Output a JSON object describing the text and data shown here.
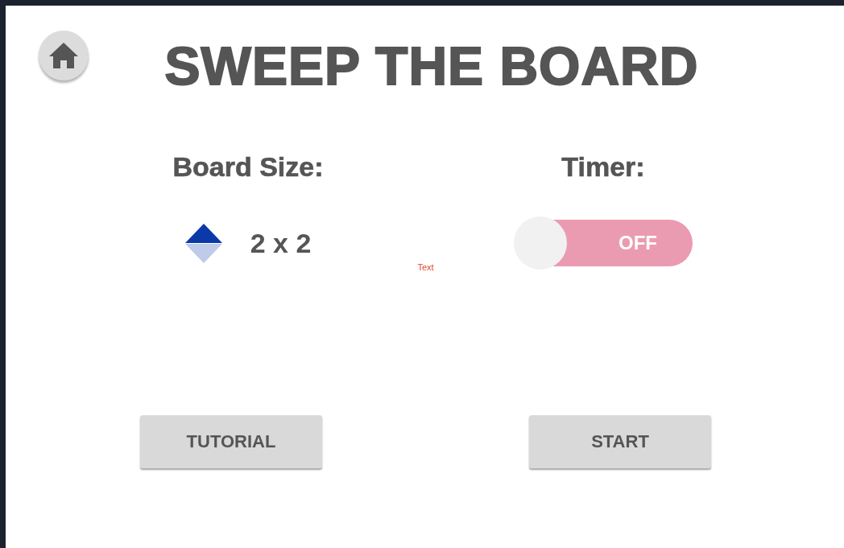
{
  "title": "SWEEP THE BOARD",
  "board_size": {
    "label": "Board Size:",
    "value": "2 x 2",
    "up_enabled": true,
    "down_enabled": false
  },
  "placeholder_label": "Text",
  "timer": {
    "label": "Timer:",
    "on": false,
    "state_text": "OFF"
  },
  "buttons": [
    {
      "label": "TUTORIAL"
    },
    {
      "label": "START"
    }
  ]
}
